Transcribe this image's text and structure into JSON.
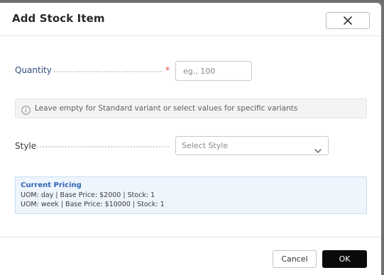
{
  "dialog": {
    "title": "Add Stock Item"
  },
  "quantity": {
    "label": "Quantity",
    "required_mark": "*",
    "placeholder": "eg., 100",
    "value": ""
  },
  "info": {
    "icon": "info-circle-icon",
    "text": "Leave empty for Standard variant or select values for specific variants"
  },
  "style": {
    "label": "Style",
    "placeholder": "Select Style",
    "icon": "chevron-down-icon"
  },
  "pricing": {
    "title": "Current Pricing",
    "lines": [
      "UOM: day | Base Price: $2000 | Stock: 1",
      "UOM: week | Base Price: $10000 | Stock: 1"
    ]
  },
  "footer": {
    "cancel_label": "Cancel",
    "ok_label": "OK"
  },
  "colors": {
    "primary_button": "#0a0a0a",
    "required": "#e0443e",
    "pricing_title": "#2f64b6",
    "pricing_bg": "#eef5fc"
  }
}
